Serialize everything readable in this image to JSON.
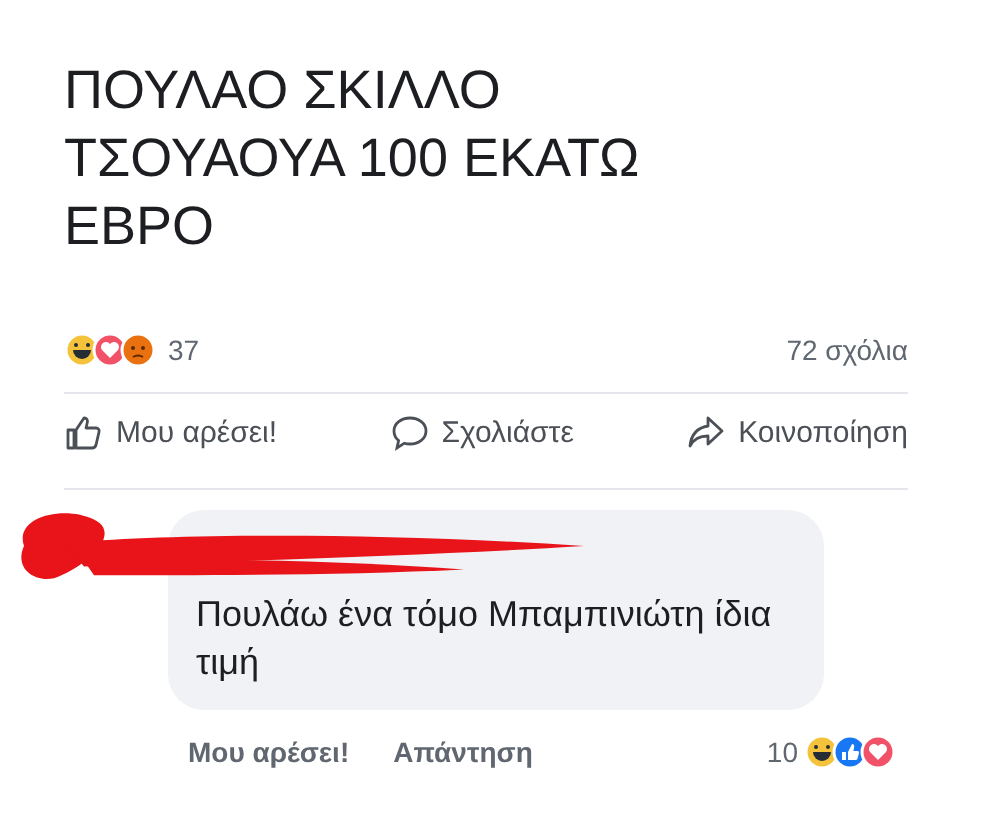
{
  "post": {
    "text_lines": [
      "ΠΟΥΛΑΟ ΣΚΙΛΛΟ",
      "ΤΣΟΥΑΟΥΑ 100 ΕΚΑΤΩ",
      "ΕΒΡΟ"
    ]
  },
  "reactions": {
    "icons": [
      {
        "kind": "haha"
      },
      {
        "kind": "love"
      },
      {
        "kind": "angry"
      }
    ],
    "count": "37",
    "comments": "72 σχόλια"
  },
  "actions": [
    {
      "kind": "like",
      "label": "Μου αρέσει!"
    },
    {
      "kind": "comment",
      "label": "Σχολιάστε"
    },
    {
      "kind": "share",
      "label": "Κοινοποίηση"
    }
  ],
  "comment": {
    "text": "Πουλάω ένα τόμο Μπαμπινιώτη ίδια τιμή",
    "actions": [
      "Μου αρέσει!",
      "Απάντηση"
    ],
    "count": "10",
    "icons": [
      {
        "kind": "haha"
      },
      {
        "kind": "like"
      },
      {
        "kind": "love"
      }
    ]
  }
}
